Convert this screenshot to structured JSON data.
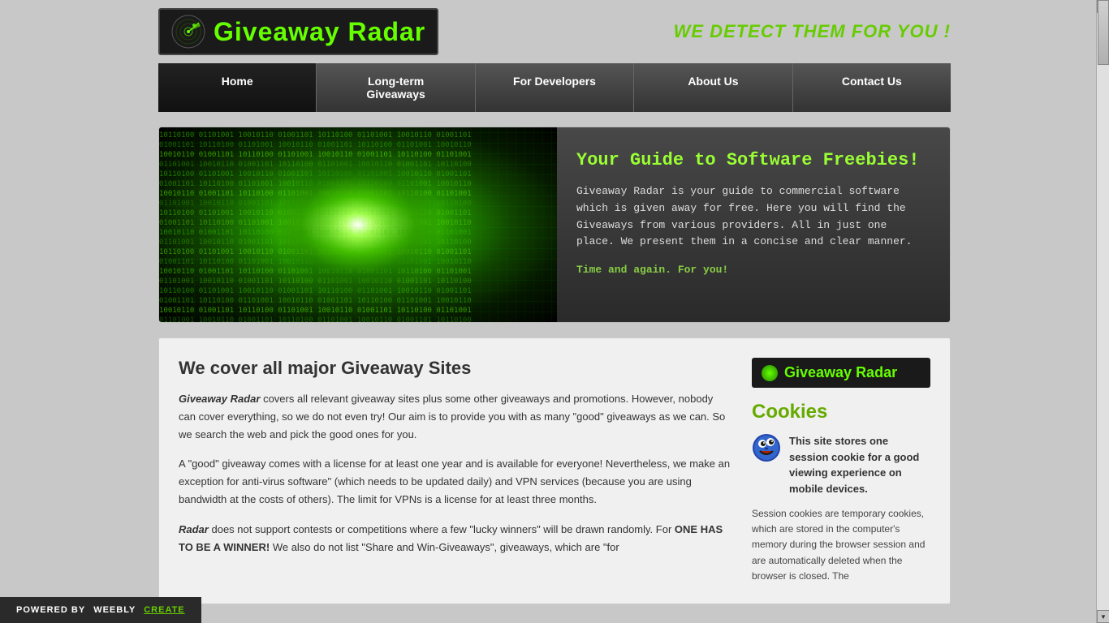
{
  "header": {
    "logo_text_main": "Giveaway ",
    "logo_text_accent": "Radar",
    "tagline": "We detect them for you !"
  },
  "nav": {
    "items": [
      {
        "label": "Home",
        "active": true
      },
      {
        "label": "Long-term Giveaways",
        "active": false
      },
      {
        "label": "For Developers",
        "active": false
      },
      {
        "label": "About Us",
        "active": false
      },
      {
        "label": "Contact Us",
        "active": false
      }
    ]
  },
  "hero": {
    "title": "Your Guide to Software Freebies!",
    "description": "Giveaway Radar  is your guide to commercial software which is given away for free. Here you will find the Giveaways from various providers.  All in just one place.  We present them in a concise and clear manner.",
    "tagline": "Time and again. For you!"
  },
  "article": {
    "title": "We cover all major Giveaway Sites",
    "paragraph1": "covers all relevant giveaway sites plus some other giveaways and promotions. However, nobody can cover everything, so we do not even try! Our aim is to provide you with as many \"good\" giveaways as we can. So we search the web and pick the good ones for you.",
    "paragraph1_brand": "Giveaway Radar",
    "paragraph2": "A \"good\" giveaway comes with a license for at least one year and is available for everyone! Nevertheless, we make an exception for anti-virus software\" (which needs to be updated daily) and VPN services (because you are using bandwidth at the costs of others). The limit for VPNs is a license for at least three months.",
    "paragraph3_prefix": "does not support contests or competitions where a few \"lucky winners\" will be drawn randomly. For",
    "paragraph3_brand": "Radar",
    "paragraph3_highlight": "ONE HAS TO BE A WINNER!",
    "paragraph3_suffix": "We also do not list \"Share and Win-Giveaways\", giveaways, which are \"for"
  },
  "sidebar": {
    "logo_text_main": "Giveaway ",
    "logo_text_accent": "Radar",
    "cookies_title": "Cookies",
    "cookie_text": "This site stores one session cookie for a good viewing experience on mobile devices.",
    "cookie_description": "Session cookies are temporary cookies, which are stored in the computer's memory during the browser session and are automatically deleted when the browser is closed. The"
  },
  "powered_by": {
    "prefix": "POWERED BY",
    "brand": "weebly",
    "link_text": "create"
  }
}
